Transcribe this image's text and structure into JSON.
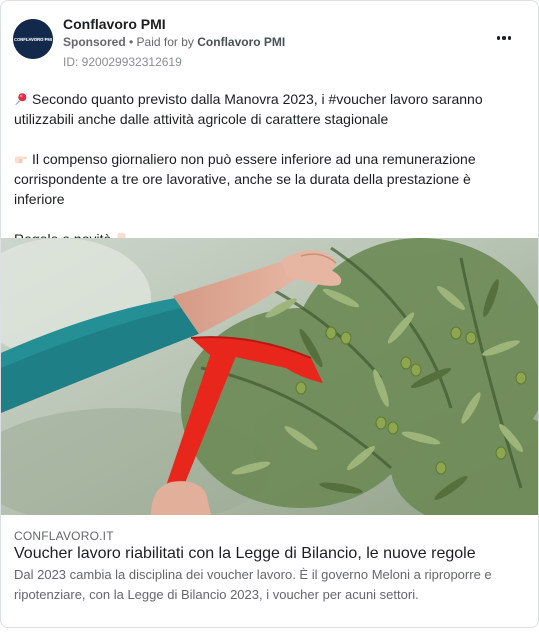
{
  "post": {
    "page_name": "Conflavoro PMI",
    "avatar_text": "CONFLAVORO PMI",
    "sponsored_label": "Sponsored",
    "separator": " • ",
    "paid_for_by_label": "Paid for by ",
    "paid_for_by_name": "Conflavoro PMI",
    "ad_id": "ID: 920029932312619",
    "more_icon": "more-horizontal-icon"
  },
  "body": {
    "paragraph_1_icon": "pushpin-icon",
    "paragraph_1": "Secondo quanto previsto dalla Manovra 2023, i #voucher lavoro saranno utilizzabili anche dalle attività agricole di carattere stagionale",
    "paragraph_2_icon": "pointing-right-hand-icon",
    "paragraph_2": "Il compenso giornaliero non può essere inferiore ad una remunerazione corrispondente a tre ore lavorative, anche se la durata della prestazione è inferiore",
    "paragraph_3": "Regole e novità",
    "paragraph_3_icon": "pointing-down-hand-icon"
  },
  "link_preview": {
    "image_description_icon": "olive-harvest-photo",
    "domain": "CONFLAVORO.IT",
    "headline": "Voucher lavoro riabilitati con la Legge di Bilancio, le nuove regole",
    "description": "Dal 2023 cambia la disciplina dei voucher lavoro. È il governo Meloni a riproporre e ripotenziare, con la Legge di Bilancio 2023, i voucher per acuni settori."
  },
  "colors": {
    "avatar_bg": "#13294b",
    "secondary_text": "#65676b",
    "sleeve": "#1e7f86",
    "rake": "#e8261c"
  }
}
